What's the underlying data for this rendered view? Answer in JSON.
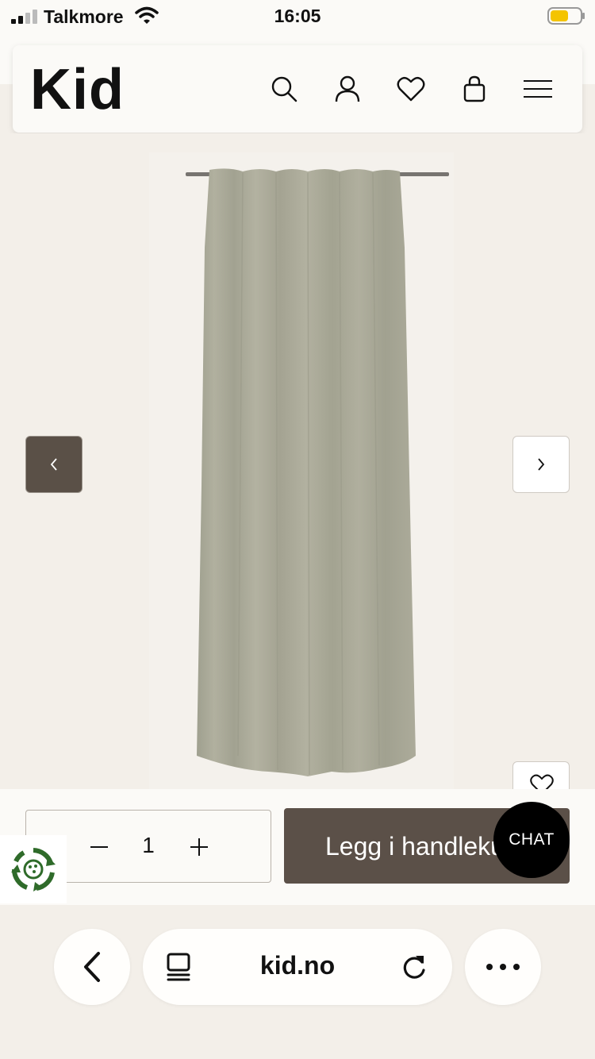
{
  "status_bar": {
    "carrier": "Talkmore",
    "time": "16:05",
    "signal_icon": "signal-icon",
    "wifi_icon": "wifi-icon",
    "battery_icon": "battery-icon",
    "battery_color": "#f4c400"
  },
  "header": {
    "logo": "Kid",
    "icons": [
      "search-icon",
      "account-icon",
      "wishlist-icon",
      "cart-icon",
      "menu-icon"
    ]
  },
  "product": {
    "image_icon": "curtain-image",
    "prev_icon": "chevron-left-icon",
    "next_icon": "chevron-right-icon",
    "favorite_icon": "heart-icon",
    "prev_bg_color": "#5a5047",
    "curtain_color": "#a9a796"
  },
  "buy_bar": {
    "quantity": "1",
    "add_to_cart_label": "Legg i handlekurv",
    "button_color": "#5b5048",
    "chat_label": "CHAT",
    "eco_icon": "recycle-badge-icon"
  },
  "browser": {
    "domain": "kid.no",
    "back_icon": "back-icon",
    "tabs_icon": "tabs-icon",
    "reload_icon": "reload-icon",
    "more_icon": "more-icon"
  }
}
